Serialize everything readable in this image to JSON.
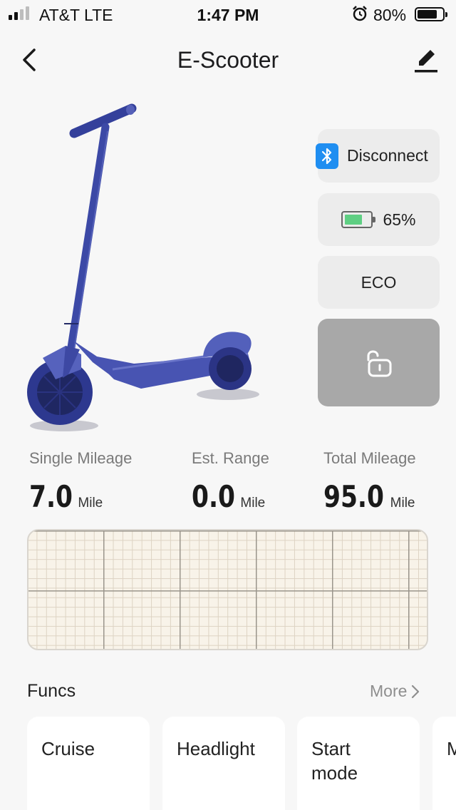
{
  "status_bar": {
    "carrier": "AT&T   LTE",
    "time": "1:47 PM",
    "battery_percent": "80%",
    "battery_level": 0.8
  },
  "nav": {
    "title": "E-Scooter"
  },
  "controls": {
    "bluetooth_label": "Disconnect",
    "battery_label": "65%",
    "battery_level": 0.65,
    "mode_label": "ECO"
  },
  "stats": [
    {
      "label": "Single Mileage",
      "value": "7.0",
      "unit": "Mile"
    },
    {
      "label": "Est. Range",
      "value": "0.0",
      "unit": "Mile"
    },
    {
      "label": "Total Mileage",
      "value": "95.0",
      "unit": "Mile"
    }
  ],
  "funcs": {
    "title": "Funcs",
    "more_label": "More",
    "cards": [
      {
        "label": "Cruise"
      },
      {
        "label": "Headlight"
      },
      {
        "label": "Start mode"
      },
      {
        "label": "M"
      }
    ]
  },
  "colors": {
    "scooter": "#3b47a0",
    "bluetooth": "#1f8ef1",
    "battery_fill": "#5fcf83",
    "lock_bg": "#a8a8a8"
  }
}
